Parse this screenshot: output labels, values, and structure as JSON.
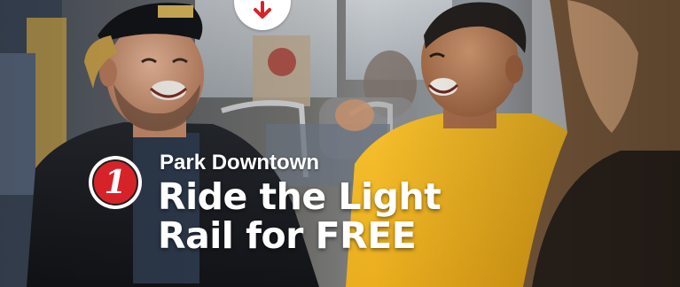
{
  "banner": {
    "step_number": "1",
    "eyebrow": "Park Downtown",
    "headline_line1": "Ride the Light",
    "headline_line2": "Rail for FREE"
  },
  "colors": {
    "accent_red": "#d6232a",
    "shirt_yellow": "#f2b31c",
    "text_white": "#ffffff"
  },
  "icons": {
    "top_badge": "arrow-down-icon",
    "photo": "light-rail-passengers-photo"
  }
}
